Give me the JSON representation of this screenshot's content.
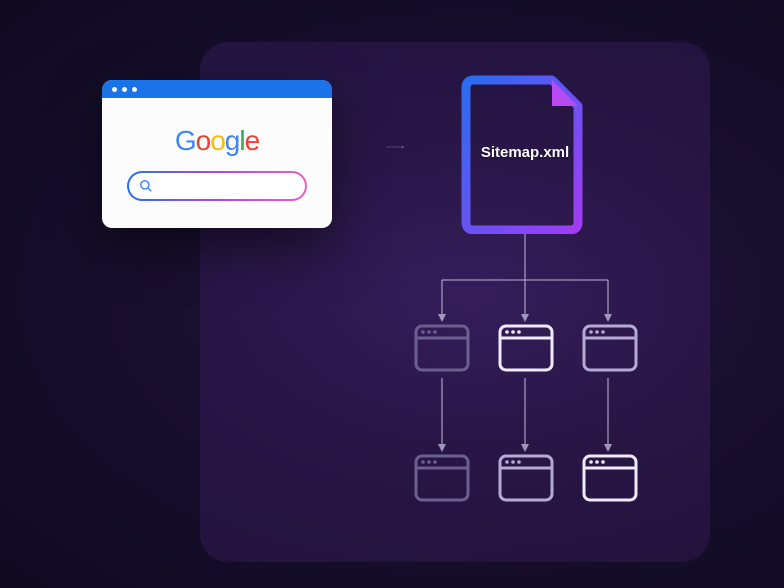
{
  "diagram": {
    "search_engine_logo": "Google",
    "logo_letters": [
      "G",
      "o",
      "o",
      "g",
      "l",
      "e"
    ],
    "file_label": "Sitemap.xml",
    "page_rows": 2,
    "pages_per_row": 3,
    "colors": {
      "file_gradient_start": "#2a6cf0",
      "file_gradient_end": "#a23bf5",
      "file_fold": "#b84bf2",
      "accent_arrow": "#b9b4d0"
    }
  }
}
